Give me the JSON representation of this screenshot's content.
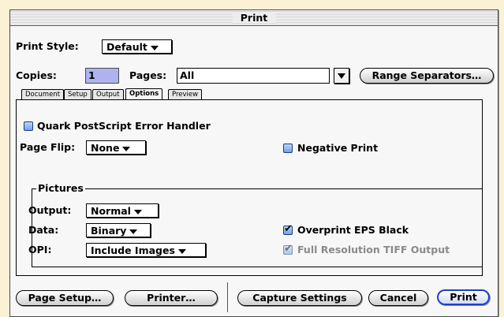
{
  "window": {
    "title": "Print"
  },
  "print_style": {
    "label": "Print Style:",
    "value": "Default"
  },
  "copies": {
    "label": "Copies:",
    "value": "1"
  },
  "pages": {
    "label": "Pages:",
    "value": "All"
  },
  "buttons": {
    "range_separators": "Range Separators…",
    "page_setup": "Page Setup…",
    "printer": "Printer…",
    "capture_settings": "Capture Settings",
    "cancel": "Cancel",
    "print": "Print"
  },
  "tabs": [
    "Document",
    "Setup",
    "Output",
    "Options",
    "Preview"
  ],
  "active_tab": "Options",
  "options": {
    "quark_error_handler": {
      "label": "Quark PostScript Error Handler",
      "checked": false
    },
    "page_flip": {
      "label": "Page Flip:",
      "value": "None"
    },
    "negative_print": {
      "label": "Negative Print",
      "checked": false
    },
    "pictures": {
      "title": "Pictures",
      "output": {
        "label": "Output:",
        "value": "Normal"
      },
      "data": {
        "label": "Data:",
        "value": "Binary"
      },
      "opi": {
        "label": "OPI:",
        "value": "Include Images"
      },
      "overprint_eps_black": {
        "label": "Overprint EPS Black",
        "checked": true
      },
      "full_res_tiff": {
        "label": "Full Resolution TIFF Output",
        "checked": true,
        "enabled": false
      }
    }
  },
  "colors": {
    "accent": "#1d3fc4",
    "field_highlight": "#aeb3f0",
    "background": "#fbf1d4"
  },
  "icons": {
    "dropdown": "triangle-down-icon",
    "checkbox": "checkmark-icon"
  }
}
